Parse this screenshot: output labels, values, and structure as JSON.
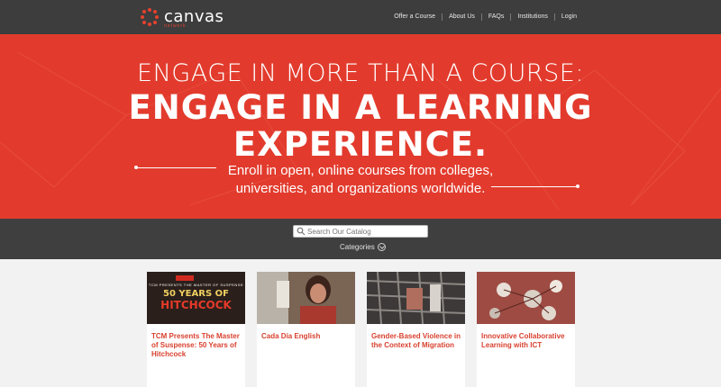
{
  "brand": {
    "name": "canvas",
    "tagline": "network"
  },
  "nav": [
    {
      "label": "Offer a Course"
    },
    {
      "label": "About Us"
    },
    {
      "label": "FAQs"
    },
    {
      "label": "Institutions"
    },
    {
      "label": "Login"
    }
  ],
  "hero": {
    "line1": "ENGAGE IN MORE THAN A COURSE:",
    "line2": "ENGAGE IN A LEARNING",
    "line3": "EXPERIENCE.",
    "sub1": "Enroll in open, online courses from colleges,",
    "sub2": "universities, and organizations worldwide."
  },
  "search": {
    "placeholder": "Search Our Catalog",
    "categories_label": "Categories"
  },
  "courses": [
    {
      "title": "TCM Presents The Master of Suspense: 50 Years of Hitchcock",
      "image": {
        "kicker": "TCM PRESENTS THE MASTER OF SUSPENSE",
        "big1": "50 YEARS OF",
        "big2": "HITCHCOCK"
      }
    },
    {
      "title": "Cada Dia English"
    },
    {
      "title": "Gender-Based Violence in the Context of Migration"
    },
    {
      "title": "Innovative Collaborative Learning with ICT"
    }
  ],
  "colors": {
    "accent": "#e23b2d",
    "dark": "#3d3d3d"
  }
}
